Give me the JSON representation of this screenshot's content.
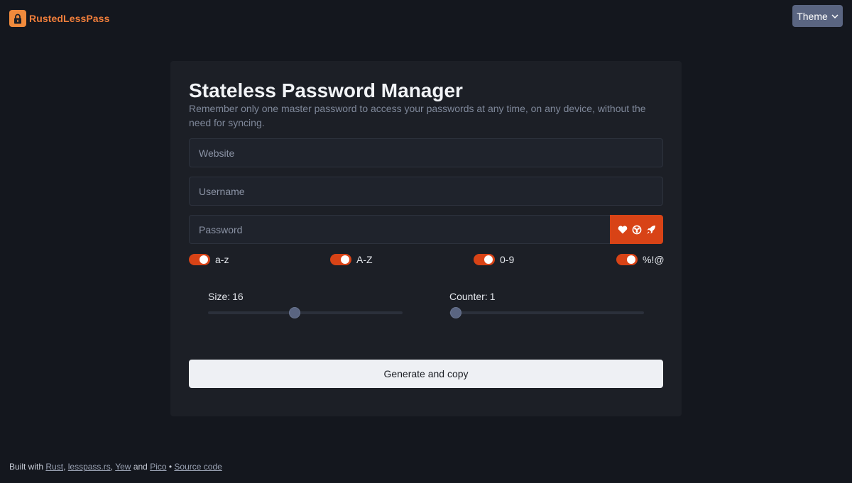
{
  "header": {
    "brand_name": "RustedLessPass",
    "brand_icon": "lock-icon",
    "theme_label": "Theme",
    "theme_icon": "chevron-down-icon"
  },
  "main": {
    "title": "Stateless Password Manager",
    "subtitle": "Remember only one master password to access your passwords at any time, on any device, without the need for syncing.",
    "website_placeholder": "Website",
    "username_placeholder": "Username",
    "password_placeholder": "Password",
    "fingerprint_icons": [
      "heart-icon",
      "biohazard-icon",
      "rocket-icon"
    ],
    "toggles": [
      {
        "label": "a-z",
        "on": true
      },
      {
        "label": "A-Z",
        "on": true
      },
      {
        "label": "0-9",
        "on": true
      },
      {
        "label": "%!@",
        "on": true
      }
    ],
    "size_label": "Size:",
    "size_value": "16",
    "counter_label": "Counter:",
    "counter_value": "1",
    "generate_label": "Generate and copy"
  },
  "footer": {
    "built_with": "Built with",
    "links": [
      "Rust",
      "lesspass.rs",
      "Yew",
      "Pico",
      "Source code"
    ],
    "separator_and": "and",
    "bullet": "•"
  },
  "colors": {
    "accent": "#d84316",
    "brand": "#f07e3b",
    "background": "#14171e",
    "card": "#1c1f26"
  }
}
